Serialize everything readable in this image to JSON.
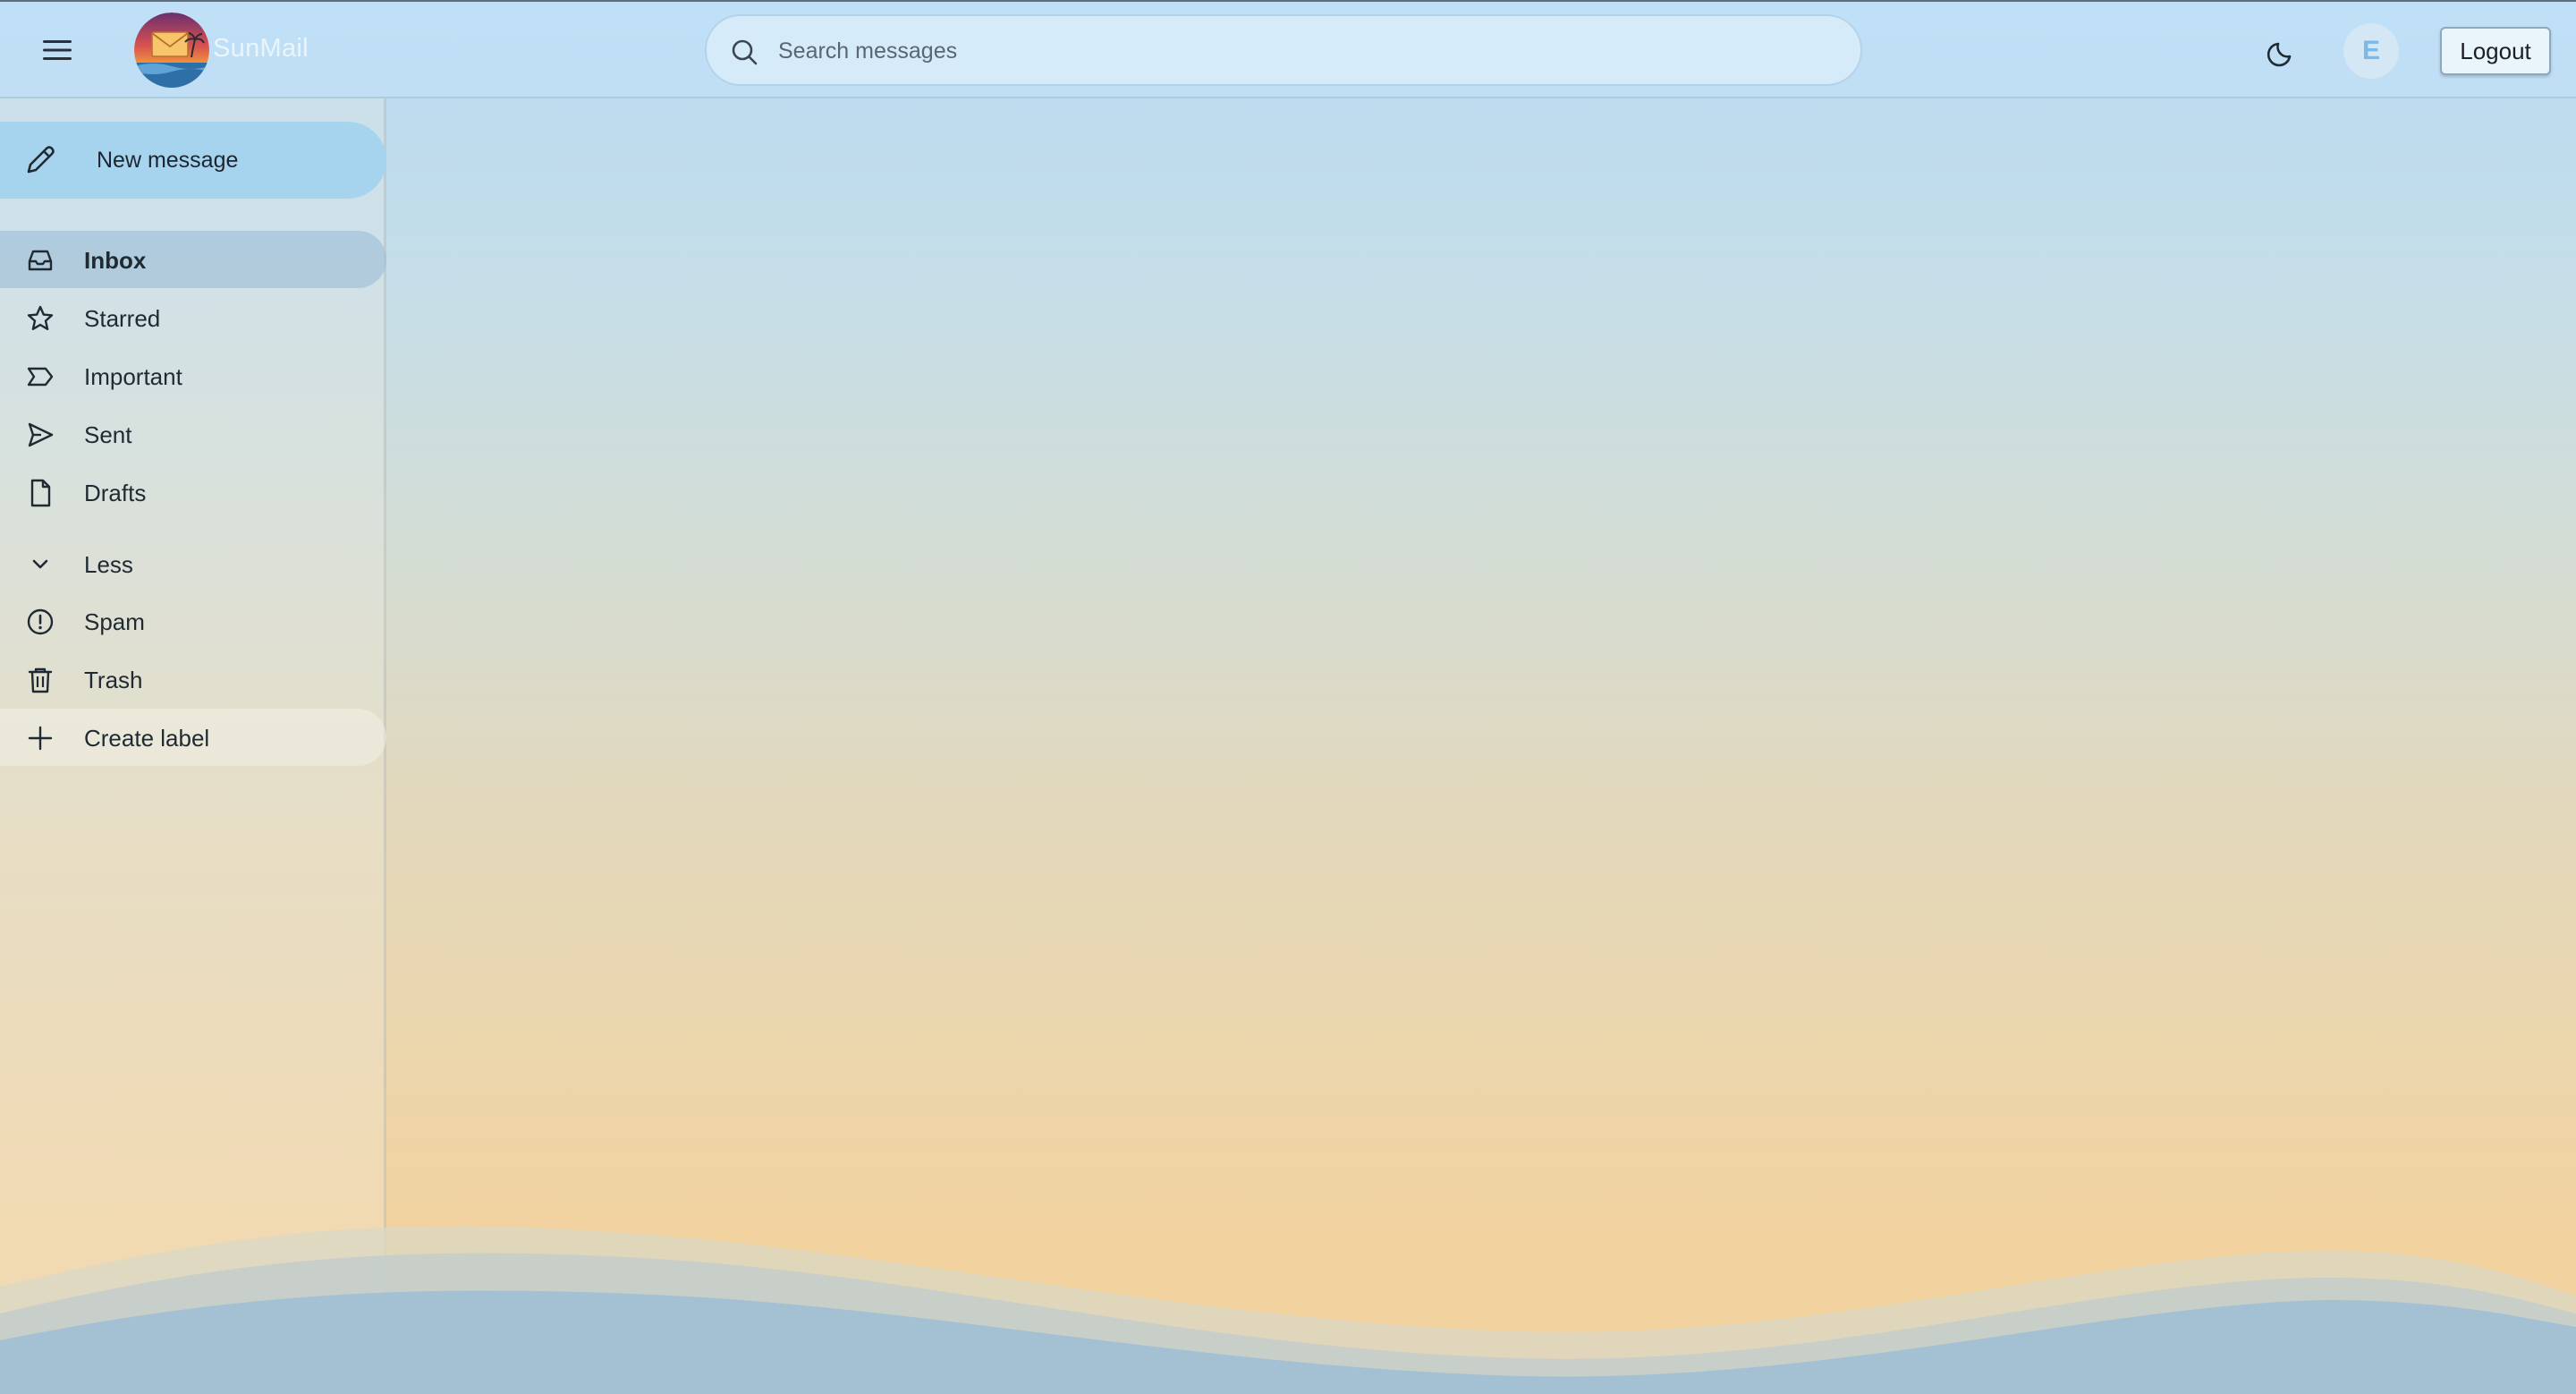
{
  "app": {
    "brand": "SunMail"
  },
  "search": {
    "placeholder": "Search messages"
  },
  "header": {
    "avatar_initial": "E",
    "logout_label": "Logout"
  },
  "compose": {
    "label": "New message"
  },
  "sidebar": {
    "items": [
      {
        "label": "Inbox",
        "icon": "inbox-icon",
        "active": true
      },
      {
        "label": "Starred",
        "icon": "star-icon"
      },
      {
        "label": "Important",
        "icon": "label-important-icon"
      },
      {
        "label": "Sent",
        "icon": "send-icon"
      },
      {
        "label": "Drafts",
        "icon": "file-icon"
      },
      {
        "label": "Less",
        "icon": "chevron-down-icon"
      },
      {
        "label": "Spam",
        "icon": "alert-circle-icon"
      },
      {
        "label": "Trash",
        "icon": "trash-icon"
      },
      {
        "label": "Create label",
        "icon": "plus-icon"
      }
    ]
  },
  "colors": {
    "sky": "#b9dcf3",
    "sand": "#f3d1a0",
    "compose": "#a6d4ef",
    "active_item": "#a0bed7",
    "sea": "#9fbfd3"
  }
}
